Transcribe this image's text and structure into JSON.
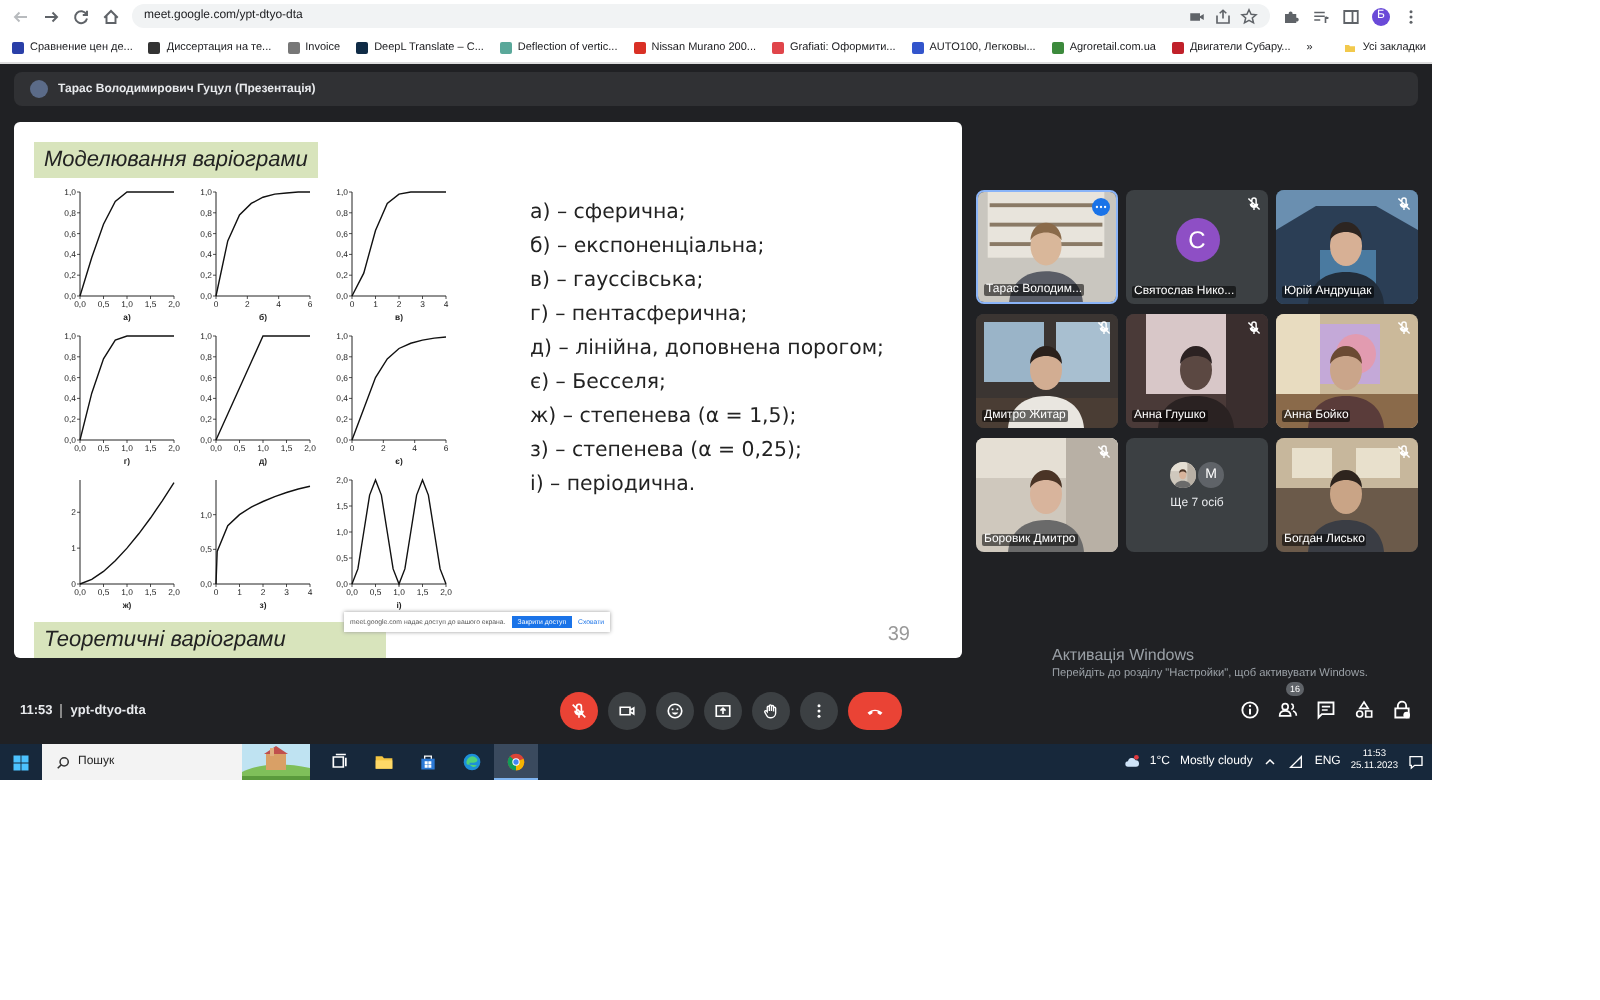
{
  "browser": {
    "url": "meet.google.com/ypt-dtyo-dta",
    "profile_initial": "Б",
    "overflow": "»",
    "all_bookmarks": "Усі закладки",
    "bookmarks": [
      {
        "label": "Сравнение цен де...",
        "color": "#2a3fa8"
      },
      {
        "label": "Диссертация на те...",
        "color": "#333333"
      },
      {
        "label": "Invoice",
        "color": "#777777"
      },
      {
        "label": "DeepL Translate – С...",
        "color": "#0f2b46"
      },
      {
        "label": "Deflection of vertic...",
        "color": "#5aa89a"
      },
      {
        "label": "Nissan Murano 200...",
        "color": "#d93025"
      },
      {
        "label": "Grafiati: Оформити...",
        "color": "#e0454a"
      },
      {
        "label": "AUTO100, Легковы...",
        "color": "#3355cc"
      },
      {
        "label": "Agroretail.com.ua",
        "color": "#3c8a3c"
      },
      {
        "label": "Двигатели Субару...",
        "color": "#c0202a"
      }
    ]
  },
  "meet": {
    "presenter": "Тарас Володимирович Гуцул (Презентація)",
    "slide": {
      "title": "Моделювання варіограми",
      "subtitle": "Теоретичні варіограми",
      "page": "39",
      "items": [
        "а) – сферична;",
        "б) – експоненціальна;",
        "в) – гауссівська;",
        "г) – пентасферична;",
        "д) – лінійна, доповнена порогом;",
        "є) – Бесселя;",
        "ж) – степенева (α = 1,5);",
        "з) – степенева (α = 0,25);",
        "і) – періодична."
      ],
      "charts": [
        {
          "chart_data": {
            "type": "line",
            "xlabel": "а)",
            "x": [
              0,
              0.25,
              0.5,
              0.75,
              1,
              1.25,
              1.5,
              1.75,
              2
            ],
            "values": [
              0,
              0.37,
              0.69,
              0.91,
              1,
              1,
              1,
              1,
              1
            ],
            "xlim": [
              0,
              2
            ],
            "ylim": [
              0,
              1
            ],
            "xticks": [
              {
                "value": 0,
                "label": "0,0"
              },
              {
                "value": 0.5,
                "label": "0,5"
              },
              {
                "value": 1,
                "label": "1,0"
              },
              {
                "value": 1.5,
                "label": "1,5"
              },
              {
                "value": 2,
                "label": "2,0"
              }
            ],
            "yticks": [
              {
                "value": 0,
                "label": "0,0"
              },
              {
                "value": 0.2,
                "label": "0,2"
              },
              {
                "value": 0.4,
                "label": "0,4"
              },
              {
                "value": 0.6,
                "label": "0,6"
              },
              {
                "value": 0.8,
                "label": "0,8"
              },
              {
                "value": 1,
                "label": "1,0"
              }
            ]
          }
        },
        {
          "chart_data": {
            "type": "line",
            "xlabel": "б)",
            "x": [
              0,
              0.75,
              1.5,
              2.25,
              3,
              3.75,
              4.5,
              5.25,
              6
            ],
            "values": [
              0,
              0.53,
              0.78,
              0.89,
              0.95,
              0.98,
              0.99,
              1,
              1
            ],
            "xlim": [
              0,
              6
            ],
            "ylim": [
              0,
              1
            ],
            "xticks": [
              0,
              2,
              4,
              6
            ],
            "yticks": [
              {
                "value": 0,
                "label": "0,0"
              },
              {
                "value": 0.2,
                "label": "0,2"
              },
              {
                "value": 0.4,
                "label": "0,4"
              },
              {
                "value": 0.6,
                "label": "0,6"
              },
              {
                "value": 0.8,
                "label": "0,8"
              },
              {
                "value": 1,
                "label": "1,0"
              }
            ]
          }
        },
        {
          "chart_data": {
            "type": "line",
            "xlabel": "в)",
            "x": [
              0,
              0.5,
              1,
              1.5,
              2,
              2.5,
              3,
              3.5,
              4
            ],
            "values": [
              0,
              0.22,
              0.63,
              0.89,
              0.98,
              1,
              1,
              1,
              1
            ],
            "xlim": [
              0,
              4
            ],
            "ylim": [
              0,
              1
            ],
            "xticks": [
              0,
              1,
              2,
              3,
              4
            ],
            "yticks": [
              {
                "value": 0,
                "label": "0,0"
              },
              {
                "value": 0.2,
                "label": "0,2"
              },
              {
                "value": 0.4,
                "label": "0,4"
              },
              {
                "value": 0.6,
                "label": "0,6"
              },
              {
                "value": 0.8,
                "label": "0,8"
              },
              {
                "value": 1,
                "label": "1,0"
              }
            ]
          }
        },
        {
          "chart_data": {
            "type": "line",
            "xlabel": "г)",
            "x": [
              0,
              0.25,
              0.5,
              0.75,
              1,
              1.25,
              1.5,
              1.75,
              2
            ],
            "values": [
              0,
              0.45,
              0.78,
              0.96,
              1,
              1,
              1,
              1,
              1
            ],
            "xlim": [
              0,
              2
            ],
            "ylim": [
              0,
              1
            ],
            "xticks": [
              {
                "value": 0,
                "label": "0,0"
              },
              {
                "value": 0.5,
                "label": "0,5"
              },
              {
                "value": 1,
                "label": "1,0"
              },
              {
                "value": 1.5,
                "label": "1,5"
              },
              {
                "value": 2,
                "label": "2,0"
              }
            ],
            "yticks": [
              {
                "value": 0,
                "label": "0,0"
              },
              {
                "value": 0.2,
                "label": "0,2"
              },
              {
                "value": 0.4,
                "label": "0,4"
              },
              {
                "value": 0.6,
                "label": "0,6"
              },
              {
                "value": 0.8,
                "label": "0,8"
              },
              {
                "value": 1,
                "label": "1,0"
              }
            ]
          }
        },
        {
          "chart_data": {
            "type": "line",
            "xlabel": "д)",
            "x": [
              0,
              0.25,
              0.5,
              0.75,
              1,
              1.25,
              1.5,
              1.75,
              2
            ],
            "values": [
              0,
              0.25,
              0.5,
              0.75,
              1,
              1,
              1,
              1,
              1
            ],
            "xlim": [
              0,
              2
            ],
            "ylim": [
              0,
              1
            ],
            "xticks": [
              {
                "value": 0,
                "label": "0,0"
              },
              {
                "value": 0.5,
                "label": "0,5"
              },
              {
                "value": 1,
                "label": "1,0"
              },
              {
                "value": 1.5,
                "label": "1,5"
              },
              {
                "value": 2,
                "label": "2,0"
              }
            ],
            "yticks": [
              {
                "value": 0,
                "label": "0,0"
              },
              {
                "value": 0.2,
                "label": "0,2"
              },
              {
                "value": 0.4,
                "label": "0,4"
              },
              {
                "value": 0.6,
                "label": "0,6"
              },
              {
                "value": 0.8,
                "label": "0,8"
              },
              {
                "value": 1,
                "label": "1,0"
              }
            ]
          }
        },
        {
          "chart_data": {
            "type": "line",
            "xlabel": "є)",
            "x": [
              0,
              0.75,
              1.5,
              2.25,
              3,
              3.75,
              4.5,
              5.25,
              6
            ],
            "values": [
              0,
              0.3,
              0.6,
              0.78,
              0.88,
              0.93,
              0.96,
              0.98,
              0.99
            ],
            "xlim": [
              0,
              6
            ],
            "ylim": [
              0,
              1
            ],
            "xticks": [
              0,
              2,
              4,
              6
            ],
            "yticks": [
              {
                "value": 0,
                "label": "0,0"
              },
              {
                "value": 0.2,
                "label": "0,2"
              },
              {
                "value": 0.4,
                "label": "0,4"
              },
              {
                "value": 0.6,
                "label": "0,6"
              },
              {
                "value": 0.8,
                "label": "0,8"
              },
              {
                "value": 1,
                "label": "1,0"
              }
            ]
          }
        },
        {
          "chart_data": {
            "type": "line",
            "xlabel": "ж)",
            "x": [
              0,
              0.25,
              0.5,
              0.75,
              1,
              1.25,
              1.5,
              1.75,
              2
            ],
            "values": [
              0,
              0.13,
              0.35,
              0.65,
              1,
              1.4,
              1.84,
              2.32,
              2.83
            ],
            "xlim": [
              0,
              2
            ],
            "ylim": [
              0,
              2.9
            ],
            "xticks": [
              {
                "value": 0,
                "label": "0,0"
              },
              {
                "value": 0.5,
                "label": "0,5"
              },
              {
                "value": 1,
                "label": "1,0"
              },
              {
                "value": 1.5,
                "label": "1,5"
              },
              {
                "value": 2,
                "label": "2,0"
              }
            ],
            "yticks": [
              0,
              1,
              2
            ]
          }
        },
        {
          "chart_data": {
            "type": "line",
            "xlabel": "з)",
            "x": [
              0,
              0.05,
              0.5,
              1,
              1.5,
              2,
              2.5,
              3,
              3.5,
              4
            ],
            "values": [
              0,
              0.47,
              0.84,
              1,
              1.11,
              1.19,
              1.26,
              1.32,
              1.37,
              1.41
            ],
            "xlim": [
              0,
              4
            ],
            "ylim": [
              0,
              1.5
            ],
            "xticks": [
              0,
              1,
              2,
              3,
              4
            ],
            "yticks": [
              {
                "value": 0,
                "label": "0,0"
              },
              {
                "value": 0.5,
                "label": "0,5"
              },
              {
                "value": 1,
                "label": "1,0"
              }
            ]
          }
        },
        {
          "chart_data": {
            "type": "line",
            "xlabel": "і)",
            "x": [
              0,
              0.125,
              0.25,
              0.375,
              0.5,
              0.625,
              0.75,
              0.875,
              1,
              1.125,
              1.25,
              1.375,
              1.5,
              1.625,
              1.75,
              1.875,
              2
            ],
            "values": [
              0,
              0.29,
              1,
              1.71,
              2,
              1.71,
              1,
              0.29,
              0,
              0.29,
              1,
              1.71,
              2,
              1.71,
              1,
              0.29,
              0
            ],
            "xlim": [
              0,
              2
            ],
            "ylim": [
              0,
              2
            ],
            "xticks": [
              {
                "value": 0,
                "label": "0,0"
              },
              {
                "value": 0.5,
                "label": "0,5"
              },
              {
                "value": 1,
                "label": "1,0"
              },
              {
                "value": 1.5,
                "label": "1,5"
              },
              {
                "value": 2,
                "label": "2,0"
              }
            ],
            "yticks": [
              {
                "value": 0,
                "label": "0,0"
              },
              {
                "value": 0.5,
                "label": "0,5"
              },
              {
                "value": 1,
                "label": "1,0"
              },
              {
                "value": 1.5,
                "label": "1,5"
              },
              {
                "value": 2,
                "label": "2,0"
              }
            ]
          }
        }
      ]
    },
    "share_notice": {
      "text": "meet.google.com надає доступ до вашого екрана.",
      "button": "Закрити доступ",
      "link": "Сховати"
    },
    "tiles": [
      {
        "kind": "video",
        "name": "Тарас Володим...",
        "muted": false,
        "highlighted": true
      },
      {
        "kind": "avatar",
        "name": "Святослав Нико...",
        "muted": true,
        "highlighted": false,
        "initial": "С"
      },
      {
        "kind": "video",
        "name": "Юрій Андрущак",
        "muted": true,
        "highlighted": false
      },
      {
        "kind": "video",
        "name": "Дмитро Житар",
        "muted": true,
        "highlighted": false
      },
      {
        "kind": "video",
        "name": "Анна Глушко",
        "muted": true,
        "highlighted": false
      },
      {
        "kind": "video",
        "name": "Анна Бойко",
        "muted": true,
        "highlighted": false
      },
      {
        "kind": "video",
        "name": "Боровик Дмитро",
        "muted": true,
        "highlighted": false
      },
      {
        "kind": "more",
        "name": "Ще 7 осіб",
        "initial": "M"
      },
      {
        "kind": "video",
        "name": "Богдан Лисько",
        "muted": true,
        "highlighted": false
      }
    ],
    "time": "11:53",
    "meeting_code": "ypt-dtyo-dta",
    "controls": [
      {
        "kind": "mic",
        "on": false
      },
      {
        "kind": "camera",
        "on": true
      },
      {
        "kind": "emoji"
      },
      {
        "kind": "present"
      },
      {
        "kind": "hand"
      },
      {
        "kind": "more"
      },
      {
        "kind": "end"
      }
    ],
    "side_controls": [
      {
        "kind": "info"
      },
      {
        "kind": "people",
        "badge": "16"
      },
      {
        "kind": "chat"
      },
      {
        "kind": "activities"
      },
      {
        "kind": "host"
      }
    ]
  },
  "activation": {
    "title": "Активація Windows",
    "text": "Перейдіть до розділу \"Настройки\", щоб активувати Windows."
  },
  "taskbar": {
    "search_placeholder": "Пошук",
    "apps": [
      {
        "kind": "taskview",
        "selected": false
      },
      {
        "kind": "explorer",
        "selected": false
      },
      {
        "kind": "store",
        "selected": false
      },
      {
        "kind": "edge",
        "selected": false
      },
      {
        "kind": "chrome",
        "selected": true
      }
    ],
    "temperature": "1°C",
    "weather": "Mostly cloudy",
    "language": "ENG",
    "time": "11:53",
    "date": "25.11.2023"
  }
}
